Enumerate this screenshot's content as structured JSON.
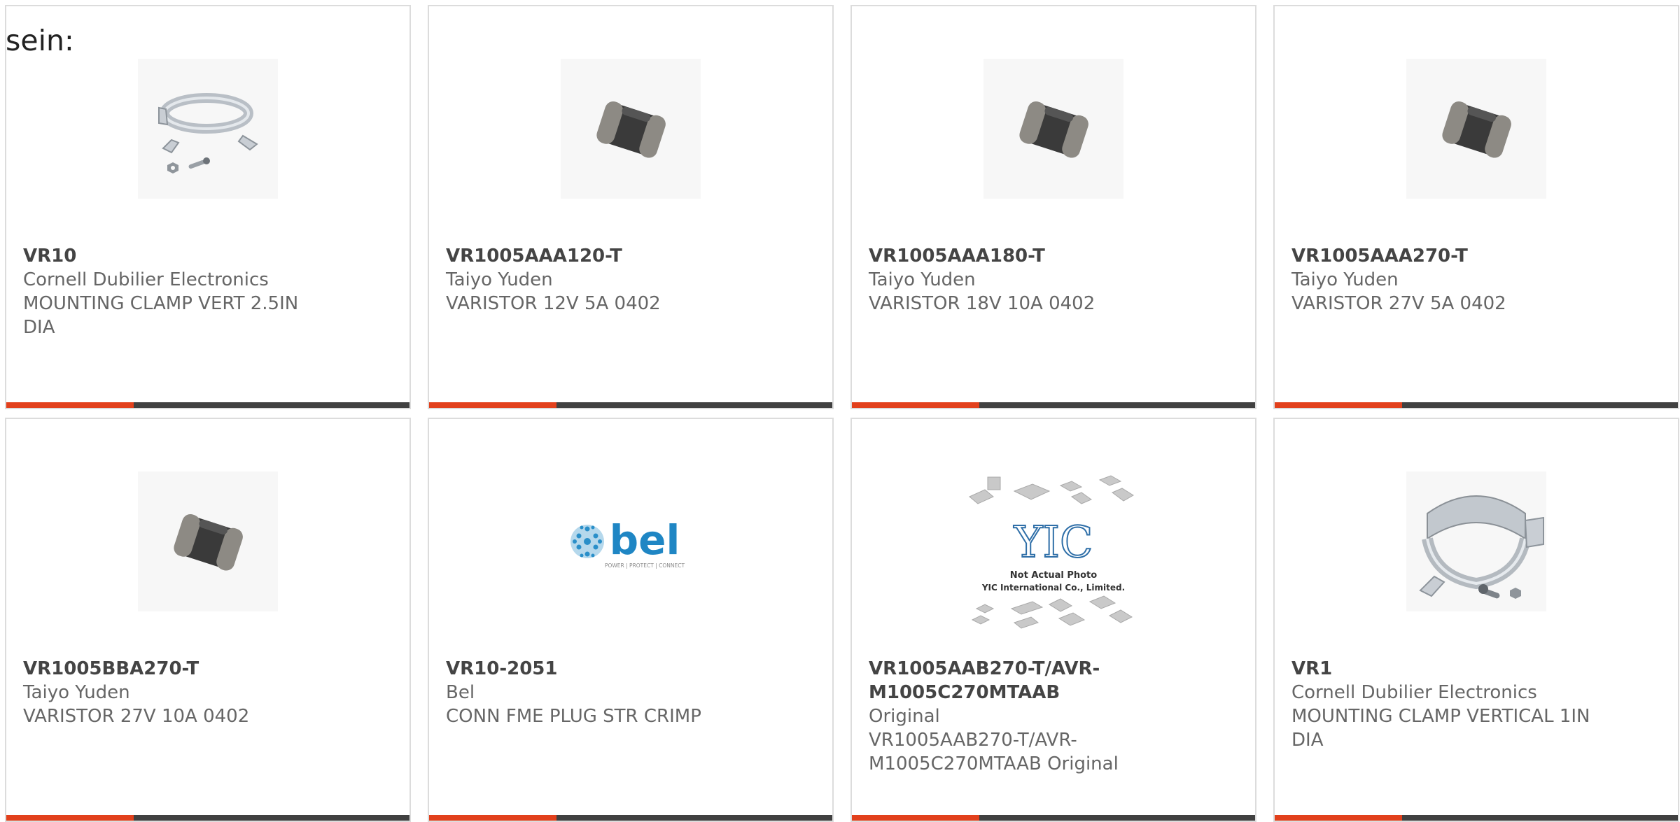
{
  "lead_text": "sein:",
  "colors": {
    "accent": "#e2401c",
    "bar": "#404040",
    "border": "#dcdcdc",
    "text": "#666666"
  },
  "products": [
    {
      "part_number": "VR10",
      "manufacturer": "Cornell Dubilier Electronics",
      "description": "MOUNTING CLAMP VERT 2.5IN DIA",
      "image": "mounting-clamp-image"
    },
    {
      "part_number": "VR1005AAA120-T",
      "manufacturer": "Taiyo Yuden",
      "description": "VARISTOR 12V 5A 0402",
      "image": "varistor-chip-image"
    },
    {
      "part_number": "VR1005AAA180-T",
      "manufacturer": "Taiyo Yuden",
      "description": "VARISTOR 18V 10A 0402",
      "image": "varistor-chip-image"
    },
    {
      "part_number": "VR1005AAA270-T",
      "manufacturer": "Taiyo Yuden",
      "description": "VARISTOR 27V 5A 0402",
      "image": "varistor-chip-image"
    },
    {
      "part_number": "VR1005BBA270-T",
      "manufacturer": "Taiyo Yuden",
      "description": "VARISTOR 27V 10A 0402",
      "image": "varistor-chip-image"
    },
    {
      "part_number": "VR10-2051",
      "manufacturer": "Bel",
      "description": "CONN FME PLUG STR CRIMP",
      "image": "bel-logo-image",
      "logo_text": "bel",
      "logo_tagline": "POWER | PROTECT | CONNECT"
    },
    {
      "part_number": "VR1005AAB270-T/AVR-M1005C270MTAAB",
      "manufacturer": "Original",
      "description": "VR1005AAB270-T/AVR-M1005C270MTAAB Original",
      "image": "yic-placeholder-image",
      "logo_text": "YIC",
      "placeholder_line1": "Not Actual Photo",
      "placeholder_line2": "YIC International Co., Limited."
    },
    {
      "part_number": "VR1",
      "manufacturer": "Cornell Dubilier Electronics",
      "description": "MOUNTING CLAMP VERTICAL 1IN DIA",
      "image": "mounting-clamp-image"
    }
  ]
}
